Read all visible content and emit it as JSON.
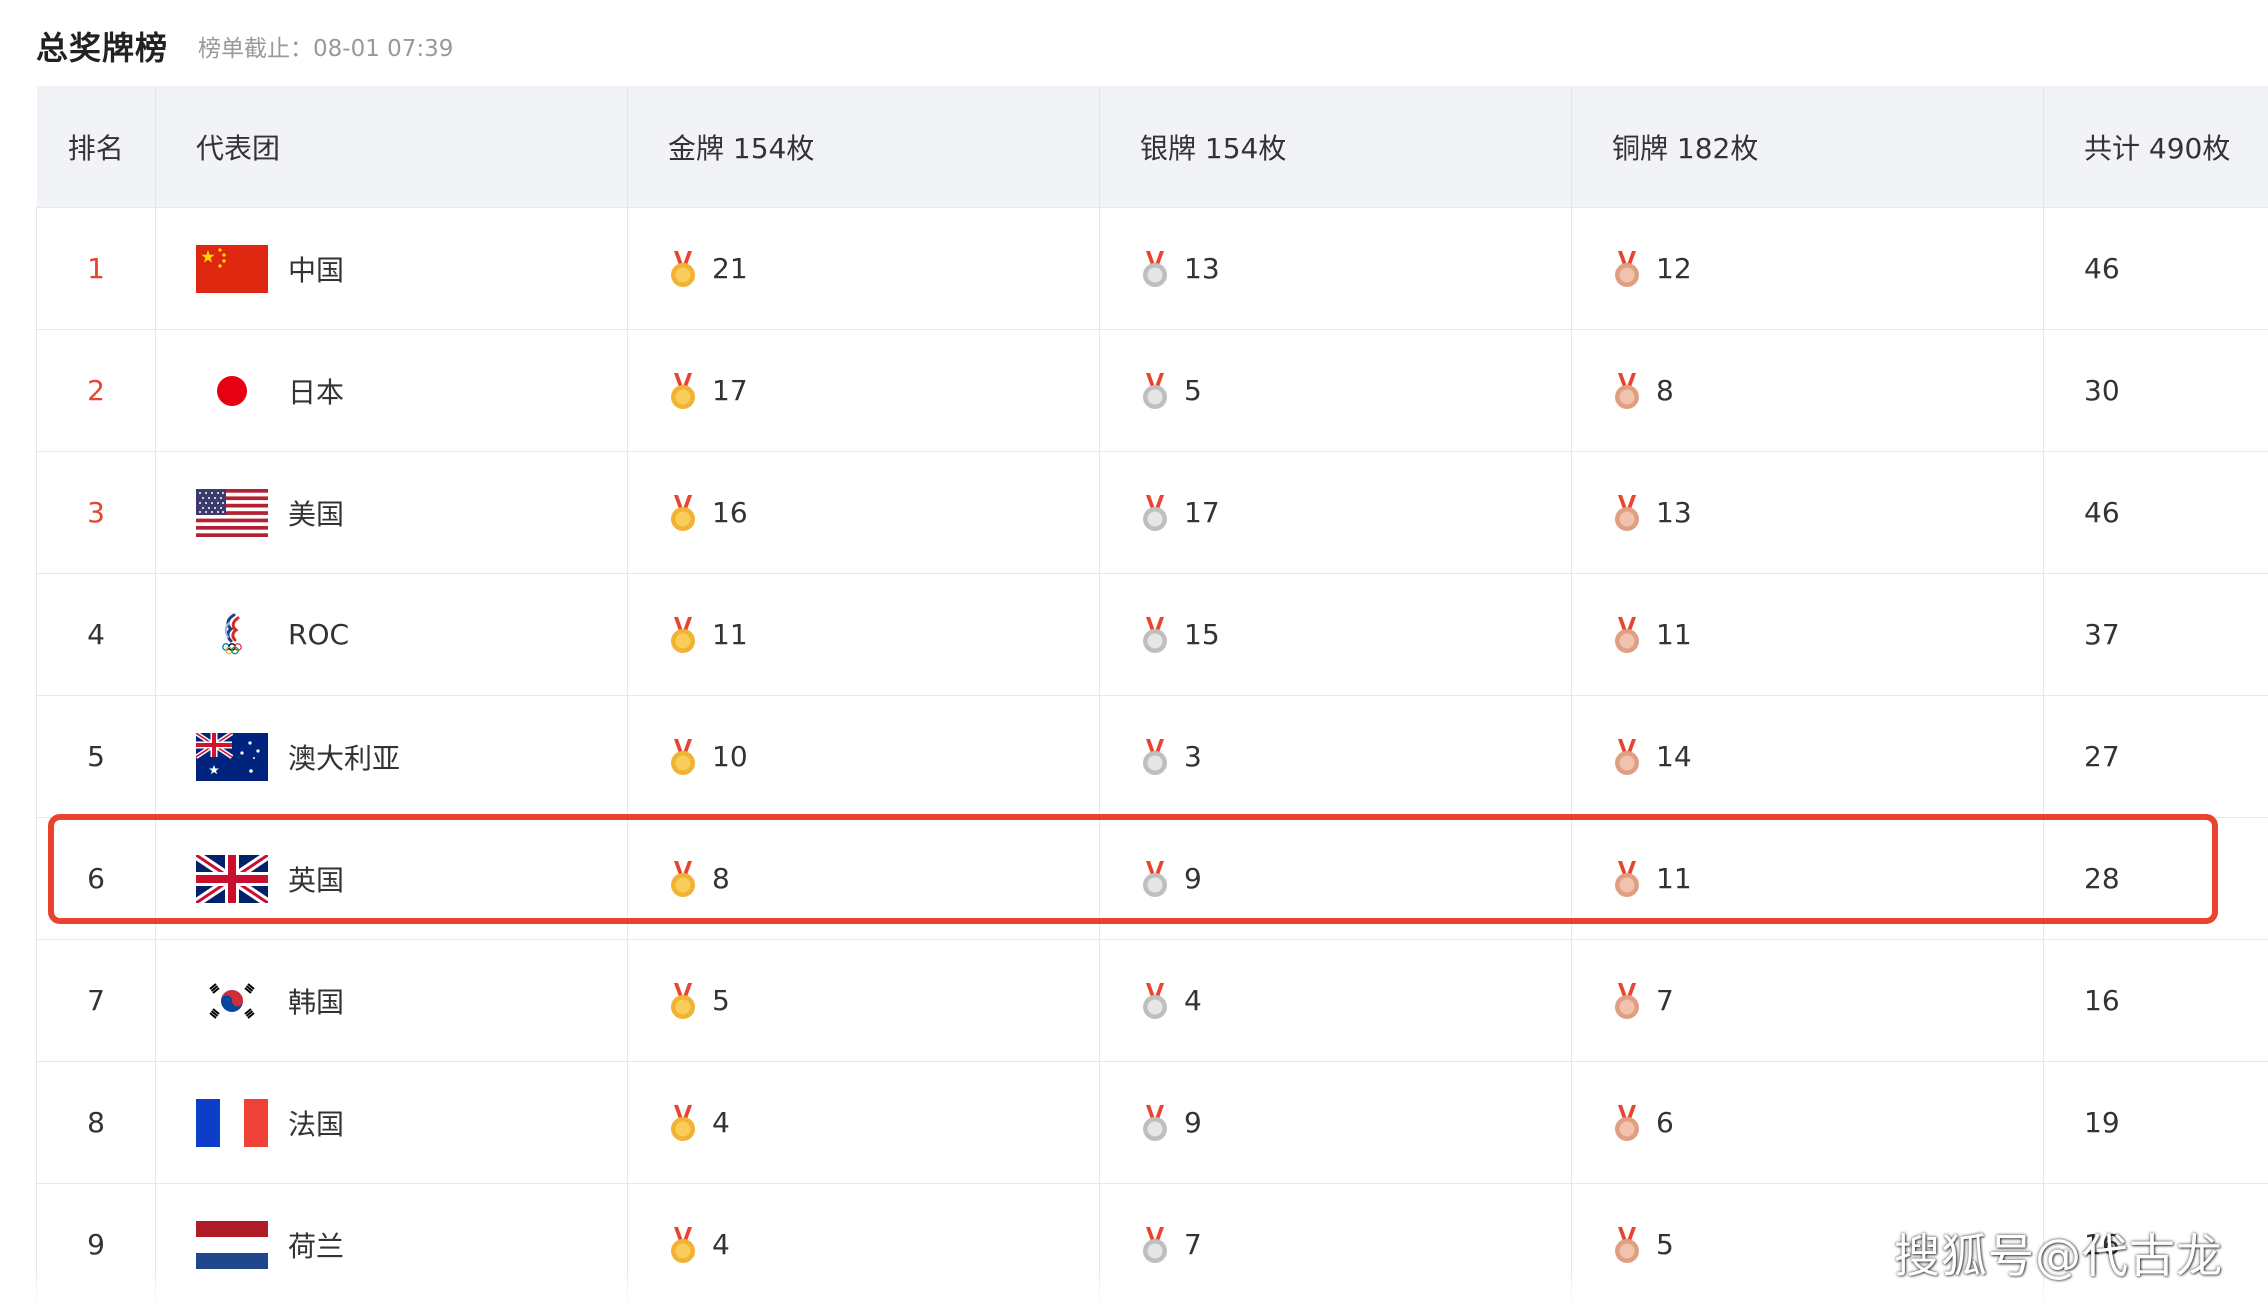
{
  "header": {
    "title": "总奖牌榜",
    "asof": "榜单截止：08-01 07:39"
  },
  "columns": {
    "rank": "排名",
    "team": "代表团",
    "gold": "金牌 154枚",
    "silver": "银牌 154枚",
    "bronze": "铜牌 182枚",
    "total": "共计 490枚"
  },
  "colors": {
    "accent": "#e8432d",
    "gold": "#f2b233",
    "silver": "#c9c9c9",
    "bronze": "#e3a589"
  },
  "rows": [
    {
      "rank": "1",
      "team": "中国",
      "flag": "china-flag",
      "gold": "21",
      "silver": "13",
      "bronze": "12",
      "total": "46"
    },
    {
      "rank": "2",
      "team": "日本",
      "flag": "japan-flag",
      "gold": "17",
      "silver": "5",
      "bronze": "8",
      "total": "30"
    },
    {
      "rank": "3",
      "team": "美国",
      "flag": "usa-flag",
      "gold": "16",
      "silver": "17",
      "bronze": "13",
      "total": "46"
    },
    {
      "rank": "4",
      "team": "ROC",
      "flag": "roc-emblem",
      "gold": "11",
      "silver": "15",
      "bronze": "11",
      "total": "37"
    },
    {
      "rank": "5",
      "team": "澳大利亚",
      "flag": "australia-flag",
      "gold": "10",
      "silver": "3",
      "bronze": "14",
      "total": "27"
    },
    {
      "rank": "6",
      "team": "英国",
      "flag": "uk-flag",
      "gold": "8",
      "silver": "9",
      "bronze": "11",
      "total": "28"
    },
    {
      "rank": "7",
      "team": "韩国",
      "flag": "korea-flag",
      "gold": "5",
      "silver": "4",
      "bronze": "7",
      "total": "16"
    },
    {
      "rank": "8",
      "team": "法国",
      "flag": "france-flag",
      "gold": "4",
      "silver": "9",
      "bronze": "6",
      "total": "19"
    },
    {
      "rank": "9",
      "team": "荷兰",
      "flag": "netherlands-flag",
      "gold": "4",
      "silver": "7",
      "bronze": "5",
      "total": "16"
    }
  ],
  "watermark": "搜狐号@代古龙"
}
